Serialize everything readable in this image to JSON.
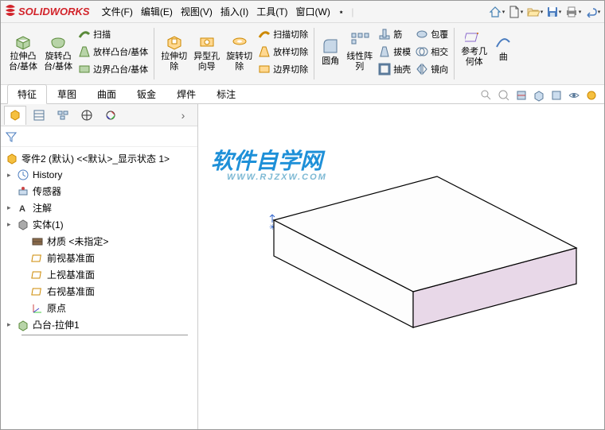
{
  "app": {
    "name": "SOLIDWORKS"
  },
  "menu": {
    "file": "文件(F)",
    "edit": "编辑(E)",
    "view": "视图(V)",
    "insert": "插入(I)",
    "tools": "工具(T)",
    "window": "窗口(W)"
  },
  "ribbon": {
    "extrude_boss": "拉伸凸\n台/基体",
    "revolve_boss": "旋转凸\n台/基体",
    "sweep": "扫描",
    "loft_boss": "放样凸台/基体",
    "boundary_boss": "边界凸台/基体",
    "extrude_cut": "拉伸切\n除",
    "hole_wizard": "异型孔\n向导",
    "revolve_cut": "旋转切\n除",
    "sweep_cut": "扫描切除",
    "loft_cut": "放样切除",
    "boundary_cut": "边界切除",
    "fillet": "圆角",
    "linear_pattern": "线性阵\n列",
    "rib": "筋",
    "draft": "拔模",
    "shell": "抽壳",
    "wrap": "包覆",
    "intersect": "相交",
    "mirror": "镜向",
    "ref_geom": "参考几\n何体",
    "curves": "曲"
  },
  "tabs": {
    "features": "特征",
    "sketch": "草图",
    "surfaces": "曲面",
    "sheetmetal": "钣金",
    "weldments": "焊件",
    "annotate": "标注"
  },
  "tree": {
    "root": "零件2 (默认) <<默认>_显示状态 1>",
    "history": "History",
    "sensors": "传感器",
    "annotations": "注解",
    "solid_bodies": "实体(1)",
    "material": "材质 <未指定>",
    "front_plane": "前视基准面",
    "top_plane": "上视基准面",
    "right_plane": "右视基准面",
    "origin": "原点",
    "boss_extrude": "凸台-拉伸1"
  },
  "watermark": {
    "title": "软件自学网",
    "url": "WWW.RJZXW.COM"
  }
}
